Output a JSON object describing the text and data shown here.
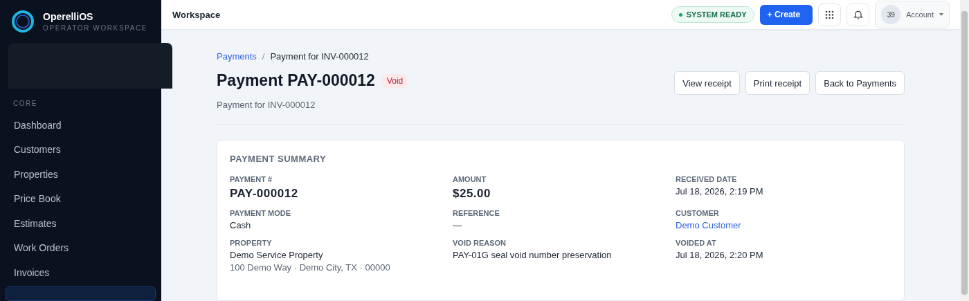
{
  "brand": {
    "name": "OperelliOS",
    "tagline": "OPERATOR WORKSPACE"
  },
  "sidebar": {
    "section": "CORE",
    "items": [
      {
        "label": "Dashboard",
        "selected": false
      },
      {
        "label": "Customers",
        "selected": false
      },
      {
        "label": "Properties",
        "selected": false
      },
      {
        "label": "Price Book",
        "selected": false
      },
      {
        "label": "Estimates",
        "selected": false
      },
      {
        "label": "Work Orders",
        "selected": false
      },
      {
        "label": "Invoices",
        "selected": false
      }
    ]
  },
  "topbar": {
    "title": "Workspace",
    "status": "SYSTEM READY",
    "create": "+ Create",
    "avatar": "39",
    "account": "Account"
  },
  "breadcrumb_separator": "/",
  "breadcrumb": [
    {
      "label": "Payments",
      "kind": "link"
    },
    {
      "label": "Payment for INV-000012",
      "kind": "current"
    }
  ],
  "page": {
    "title": "Payment PAY-000012",
    "badge": "Void",
    "subtitle": "Payment for INV-000012",
    "actions": [
      "View receipt",
      "Print receipt",
      "Back to Payments"
    ]
  },
  "summary": {
    "title": "PAYMENT SUMMARY",
    "fields": [
      {
        "label": "PAYMENT #",
        "value": "PAY-000012",
        "kind": "large"
      },
      {
        "label": "AMOUNT",
        "value": "$25.00",
        "kind": "large"
      },
      {
        "label": "RECEIVED DATE",
        "value": "Jul 18, 2026, 2:19 PM",
        "kind": "text"
      },
      {
        "label": "PAYMENT MODE",
        "value": "Cash",
        "kind": "text"
      },
      {
        "label": "REFERENCE",
        "value": "—",
        "kind": "text"
      },
      {
        "label": "CUSTOMER",
        "value": "Demo Customer",
        "kind": "link"
      },
      {
        "label": "PROPERTY",
        "value": "Demo Service Property",
        "sub": "100 Demo Way · Demo City, TX · 00000",
        "kind": "text"
      },
      {
        "label": "VOID REASON",
        "value": "PAY-01G seal void number preservation",
        "kind": "text"
      },
      {
        "label": "VOIDED AT",
        "value": "Jul 18, 2026, 2:20 PM",
        "kind": "text"
      }
    ]
  }
}
